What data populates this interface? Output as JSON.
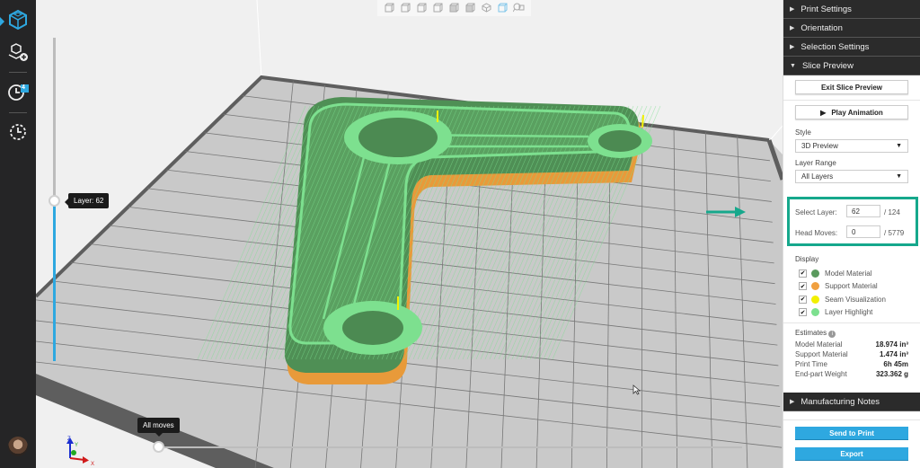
{
  "leftbar": {
    "items": [
      {
        "name": "slice-preview-cube",
        "active": true
      },
      {
        "name": "add-model"
      },
      {
        "name": "print-queue",
        "badge": "4"
      },
      {
        "name": "print-history"
      }
    ]
  },
  "view_toolbar": {
    "buttons": [
      "view-front",
      "view-back",
      "view-left",
      "view-right",
      "view-top",
      "view-bottom",
      "view-iso",
      "view-perspective",
      "view-zoom-fit"
    ]
  },
  "viewport": {
    "layer_tooltip": "Layer: 62",
    "layer_progress": 0.5,
    "moves_tooltip": "All moves",
    "moves_progress": 0,
    "axes": {
      "z": "Z",
      "y": "Y",
      "x": "X"
    }
  },
  "panel": {
    "sections": {
      "print_settings": "Print Settings",
      "orientation": "Orientation",
      "selection_settings": "Selection Settings",
      "slice_preview": "Slice Preview",
      "manufacturing_notes": "Manufacturing Notes"
    },
    "exit_slice_preview": "Exit Slice Preview",
    "play_animation": "Play Animation",
    "style_label": "Style",
    "style_value": "3D Preview",
    "layer_range_label": "Layer Range",
    "layer_range_value": "All Layers",
    "select_layer_label": "Select Layer:",
    "select_layer_value": "62",
    "select_layer_total": "/ 124",
    "head_moves_label": "Head Moves:",
    "head_moves_value": "0",
    "head_moves_total": "/ 5779",
    "display_label": "Display",
    "display_items": [
      {
        "label": "Model Material",
        "color": "#5a9a5e",
        "checked": true
      },
      {
        "label": "Support Material",
        "color": "#f0a040",
        "checked": true
      },
      {
        "label": "Seam Visualization",
        "color": "#f2f000",
        "checked": true
      },
      {
        "label": "Layer Highlight",
        "color": "#7de08f",
        "checked": true
      }
    ],
    "estimates_label": "Estimates",
    "estimates": [
      {
        "label": "Model Material",
        "value": "18.974 in³"
      },
      {
        "label": "Support Material",
        "value": "1.474 in³"
      },
      {
        "label": "Print Time",
        "value": "6h 45m"
      },
      {
        "label": "End-part Weight",
        "value": "323.362 g"
      }
    ],
    "send_to_print": "Send to Print",
    "export": "Export"
  },
  "colors": {
    "accent": "#2ea8e0",
    "highlight_box": "#16a88c",
    "model_green": "#5a9a5e",
    "layer_green": "#7de08f",
    "support_orange": "#f0a040"
  }
}
